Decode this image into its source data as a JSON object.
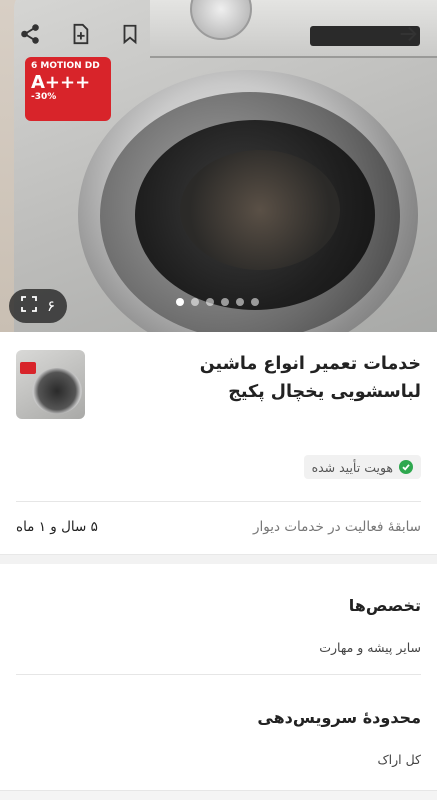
{
  "hero": {
    "image_count": "۶",
    "label_brand": "6 MOTION DD",
    "label_rating": "A+++",
    "label_saving": "-30%",
    "slides": 6,
    "active_slide": 1
  },
  "header": {
    "title": "خدمات تعمیر انواع ماشین لباسشویی یخچال پکیج",
    "verified_label": "هویت تأیید شده",
    "activity_key": "سابقهٔ فعالیت در خدمات دیوار",
    "activity_value": "۵ سال و ۱ ماه"
  },
  "specialties": {
    "heading": "تخصص‌ها",
    "value": "سایر پیشه و مهارت"
  },
  "service_area": {
    "heading": "محدودهٔ سرویس‌دهی",
    "value": "کل اراک"
  },
  "colors": {
    "verified_green": "#2fa84f",
    "label_red": "#d8242a"
  },
  "icons": [
    "share-icon",
    "add-note-icon",
    "bookmark-icon",
    "arrow-right-icon",
    "expand-icon",
    "check-icon"
  ]
}
